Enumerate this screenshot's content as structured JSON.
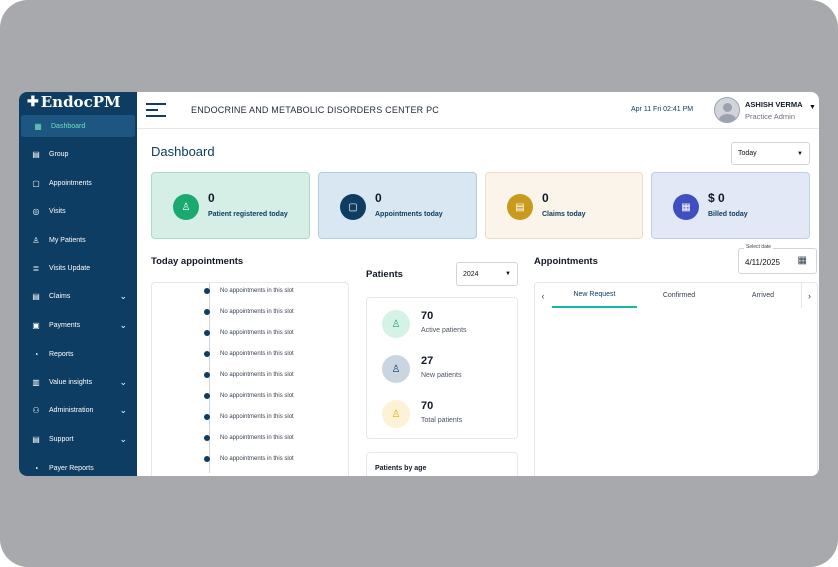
{
  "app": {
    "name": "EndocPM",
    "org_title": "ENDOCRINE AND METABOLIC DISORDERS CENTER PC",
    "datetime": "Apr 11 Fri 02:41 PM"
  },
  "user": {
    "name": "ASHISH VERMA",
    "role": "Practice Admin"
  },
  "sidebar": {
    "items": [
      {
        "label": "Dashboard",
        "icon": "grid-icon",
        "active": true
      },
      {
        "label": "Group",
        "icon": "document-icon"
      },
      {
        "label": "Appointments",
        "icon": "calendar-icon"
      },
      {
        "label": "Visits",
        "icon": "stethoscope-icon"
      },
      {
        "label": "My Patients",
        "icon": "person-icon"
      },
      {
        "label": "Visits Update",
        "icon": "list-icon"
      },
      {
        "label": "Claims",
        "icon": "claims-icon",
        "expandable": true
      },
      {
        "label": "Payments",
        "icon": "payments-icon",
        "expandable": true
      },
      {
        "label": "Reports",
        "icon": "reports-icon"
      },
      {
        "label": "Value insights",
        "icon": "bar-chart-icon",
        "expandable": true
      },
      {
        "label": "Administration",
        "icon": "admin-icon",
        "expandable": true
      },
      {
        "label": "Support",
        "icon": "support-icon",
        "expandable": true
      },
      {
        "label": "Payer Reports",
        "icon": "payer-reports-icon"
      }
    ]
  },
  "dashboard": {
    "title": "Dashboard",
    "period_select": "Today",
    "cards": [
      {
        "value": "0",
        "label": "Patient registered today",
        "icon": "user-icon",
        "bg": "#d5efe6",
        "border": "#a7dcc8",
        "circle": "#1aaa6f"
      },
      {
        "value": "0",
        "label": "Appointments today",
        "icon": "calendar-icon",
        "bg": "#d8e7f2",
        "border": "#aecde3",
        "circle": "#0d3d62"
      },
      {
        "value": "0",
        "label": "Claims today",
        "icon": "clipboard-icon",
        "bg": "#fbf4ea",
        "border": "#f2dcc0",
        "circle": "#c99a1e"
      },
      {
        "value": "$ 0",
        "label": "Billed today",
        "icon": "receipt-icon",
        "bg": "#e3e8f7",
        "border": "#c2cdee",
        "circle": "#3f4fbf"
      }
    ]
  },
  "today_appointments": {
    "title": "Today appointments",
    "slots": [
      "No appointments in this slot",
      "No appointments in this slot",
      "No appointments in this slot",
      "No appointments in this slot",
      "No appointments in this slot",
      "No appointments in this slot",
      "No appointments in this slot",
      "No appointments in this slot",
      "No appointments in this slot"
    ]
  },
  "patients": {
    "title": "Patients",
    "year_select": "2024",
    "stats": [
      {
        "value": "70",
        "label": "Active patients",
        "icon": "user-icon",
        "bg": "#d5f2e6",
        "color": "#1aaa6f"
      },
      {
        "value": "27",
        "label": "New patients",
        "icon": "user-icon",
        "bg": "#c9d6e2",
        "color": "#0d3d62"
      },
      {
        "value": "70",
        "label": "Total patients",
        "icon": "user-icon",
        "bg": "#fdf2d6",
        "color": "#e2a900"
      }
    ],
    "by_age_title": "Patients by age"
  },
  "appointments": {
    "title": "Appointments",
    "date_label": "Select date",
    "date_value": "4/11/2025",
    "tabs": [
      "New Request",
      "Confirmed",
      "Arrived"
    ],
    "active_tab": "New Request"
  }
}
